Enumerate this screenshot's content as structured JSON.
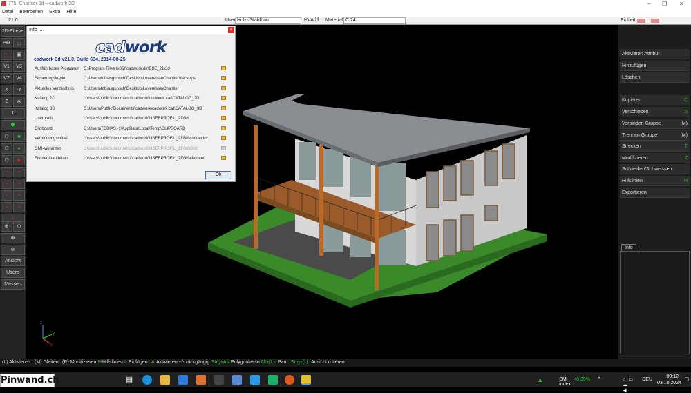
{
  "window": {
    "title": "775_Chantier.3d – cadwork 3D"
  },
  "menu": [
    "Datei",
    "Bearbeiten",
    "Extra",
    "Hilfe"
  ],
  "topstrip": {
    "value": "21.0",
    "user_label": "User",
    "user_value": "Holz-/Stahlbau",
    "hva_label": "HVA",
    "hva_value": "H",
    "material_label": "Material",
    "material_value": "C 24",
    "einheit_label": "Einheit"
  },
  "left_toolbar": {
    "ebene": "2D-Ebene",
    "per": "Per",
    "v1": "V1",
    "v3": "V3",
    "v2": "V2",
    "v4": "V4",
    "x": "X",
    "neg_y": "-Y",
    "z": "Z",
    "a": "A",
    "one": "1",
    "ansicht": "Ansicht",
    "userp": "Userp",
    "messen": "Messen"
  },
  "right_panel": {
    "items": [
      {
        "label": "Aktivieren Attribut",
        "key": ""
      },
      {
        "label": "Hinzufügen",
        "key": ""
      },
      {
        "label": "Löschen",
        "key": ""
      },
      {
        "label": "Kopieren",
        "key": "C"
      },
      {
        "label": "Verschieben",
        "key": "S"
      },
      {
        "label": "Verbinden Gruppe",
        "key": "(M)"
      },
      {
        "label": "Trennen Gruppe",
        "key": "(M)"
      },
      {
        "label": "Strecken",
        "key": "T"
      },
      {
        "label": "Modifizieren",
        "key": "Z"
      },
      {
        "label": "Schneiden/Schweissen",
        "key": ""
      },
      {
        "label": "Hilfslinien",
        "key": "H"
      },
      {
        "label": "Exportieren",
        "key": ""
      }
    ],
    "info_tab": "Info"
  },
  "dialog": {
    "title": "Info ...",
    "logo_cad": "cad",
    "logo_work": "work",
    "version": "cadwork 3d v21.0, Build 634, 2014-08-25",
    "rows": [
      {
        "label": "Ausführbares Programm",
        "path": "C:\\Program Files (x86)\\cadwork.dir\\EXE_21\\3d"
      },
      {
        "label": "Sicherungskopie",
        "path": "C:\\Users\\tobiasgunsch\\Desktop\\Loveresse\\Chantier\\backups"
      },
      {
        "label": "Aktuelles Verzeichnis",
        "path": "C:\\Users\\tobiasgunsch\\Desktop\\Loveresse\\Chantier"
      },
      {
        "label": "Katalog 2D",
        "path": "c:\\users\\public\\documents\\cadwork\\cadwork.cat\\CATALOG_2D"
      },
      {
        "label": "Katalog 3D",
        "path": "C:\\Users\\Public\\Documents\\cadwork\\cadwork.cat\\CATALOG_3D"
      },
      {
        "label": "Userprofil",
        "path": "c:\\users\\public\\documents\\cadwork\\USERPROFIL_21\\3d"
      },
      {
        "label": "Clipboard",
        "path": "C:\\Users\\TOBIAS~1\\AppData\\Local\\Temp\\CLIPBOARD"
      },
      {
        "label": "Verbindungsmittel",
        "path": "c:\\users\\public\\documents\\cadwork\\USERPROFIL_21\\3d\\connector"
      },
      {
        "label": "GMI-Varianten",
        "path": "c:\\users\\public\\documents\\cadwork\\USERPROFIL_21\\3d\\GMI"
      },
      {
        "label": "Elementbaudetails",
        "path": "c:\\users\\public\\documents\\cadwork\\USERPROFIL_21\\3d\\element"
      }
    ],
    "ok": "Ok"
  },
  "statusbar": {
    "s1": "(L) Aktivieren",
    "s2": "(M) Gleiten",
    "s3": "(R) Modifizieren",
    "s4k": "H",
    "s4": "Hilfslinien",
    "s5k": "I",
    "s5": "Einfügen",
    "s6k": "A",
    "s6": "Aktivieren +/- rückgängig",
    "s7k": "Strg+Alt:",
    "s7": "Polygonlasso",
    "s8k": "Alt+(L):",
    "s8": "Pan",
    "s9k": "Strg+(L):",
    "s9": "Ansicht rotieren"
  },
  "taskbar": {
    "watermark": "Pinwand.ch",
    "stock": "SMI index",
    "stock_change": "+0,29%",
    "lang": "DEU",
    "time": "09:12",
    "date": "03.10.2024"
  },
  "axes": {
    "z": "z",
    "y": "y",
    "x": "x"
  }
}
